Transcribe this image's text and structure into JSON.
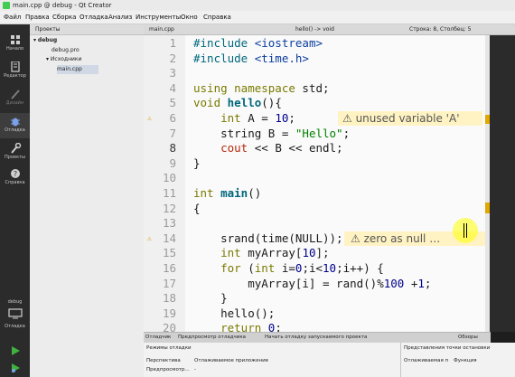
{
  "window": {
    "title": "main.cpp @ debug - Qt Creator"
  },
  "menu": [
    "Файл",
    "Правка",
    "Сборка",
    "Отладка",
    "Анализ",
    "Инструменты",
    "Окно",
    "Справка"
  ],
  "modes": [
    {
      "label": "Начало",
      "icon": "grid-icon"
    },
    {
      "label": "Редактор",
      "icon": "document-edit-icon"
    },
    {
      "label": "Дизайн",
      "icon": "pencil-icon"
    },
    {
      "label": "Отладка",
      "icon": "bug-icon"
    },
    {
      "label": "Проекты",
      "icon": "wrench-icon"
    },
    {
      "label": "Справка",
      "icon": "help-icon"
    }
  ],
  "kit": {
    "project": "debug",
    "label": "Отладка"
  },
  "projects": {
    "header": "Проекты",
    "tree": [
      {
        "label": "debug"
      },
      {
        "label": "debug.pro"
      },
      {
        "label": "Исходники"
      },
      {
        "label": "main.cpp"
      }
    ]
  },
  "editor": {
    "tab": "main.cpp",
    "symbol": "hello() -> void",
    "position": "Строка: 8, Столбец: 5",
    "lines": [
      {
        "n": "1",
        "segs": [
          [
            "pp",
            "#include "
          ],
          [
            "inc",
            "<iostream>"
          ]
        ]
      },
      {
        "n": "2",
        "segs": [
          [
            "pp",
            "#include "
          ],
          [
            "inc",
            "<time.h>"
          ]
        ]
      },
      {
        "n": "3",
        "segs": []
      },
      {
        "n": "4",
        "segs": [
          [
            "kw",
            "using namespace "
          ],
          [
            "",
            "std;"
          ]
        ]
      },
      {
        "n": "5",
        "segs": [
          [
            "kw",
            "void "
          ],
          [
            "fn",
            "hello"
          ],
          [
            "",
            "(){"
          ]
        ]
      },
      {
        "n": "6",
        "warn": true,
        "segs": [
          [
            "",
            "    "
          ],
          [
            "kw",
            "int "
          ],
          [
            "",
            "A = "
          ],
          [
            "num",
            "10"
          ],
          [
            "",
            ";"
          ]
        ]
      },
      {
        "n": "7",
        "segs": [
          [
            "",
            "    "
          ],
          [
            "",
            "string B = "
          ],
          [
            "str",
            "\"Hello\""
          ],
          [
            "",
            ";"
          ]
        ]
      },
      {
        "n": "8",
        "cur": true,
        "segs": [
          [
            "",
            "    "
          ],
          [
            "mac",
            "cout"
          ],
          [
            "",
            " << B << endl;"
          ]
        ]
      },
      {
        "n": "9",
        "segs": [
          [
            "",
            "}"
          ]
        ]
      },
      {
        "n": "10",
        "segs": []
      },
      {
        "n": "11",
        "segs": [
          [
            "kw",
            "int "
          ],
          [
            "fn",
            "main"
          ],
          [
            "",
            "()"
          ]
        ]
      },
      {
        "n": "12",
        "segs": [
          [
            "",
            "{"
          ]
        ]
      },
      {
        "n": "13",
        "segs": []
      },
      {
        "n": "14",
        "warn": true,
        "segs": [
          [
            "",
            "    "
          ],
          [
            "",
            "srand(time(NULL));"
          ]
        ]
      },
      {
        "n": "15",
        "segs": [
          [
            "",
            "    "
          ],
          [
            "kw",
            "int "
          ],
          [
            "",
            "myArray["
          ],
          [
            "num",
            "10"
          ],
          [
            "",
            "];"
          ]
        ]
      },
      {
        "n": "16",
        "segs": [
          [
            "",
            "    "
          ],
          [
            "kw",
            "for "
          ],
          [
            "",
            "("
          ],
          [
            "kw",
            "int "
          ],
          [
            "",
            "i="
          ],
          [
            "num",
            "0"
          ],
          [
            "",
            ";i<"
          ],
          [
            "num",
            "10"
          ],
          [
            "",
            ";i++) {"
          ]
        ]
      },
      {
        "n": "17",
        "segs": [
          [
            "",
            "        myArray[i] = rand()%"
          ],
          [
            "num",
            "100"
          ],
          [
            "",
            " +"
          ],
          [
            "num",
            "1"
          ],
          [
            "",
            ";"
          ]
        ]
      },
      {
        "n": "18",
        "segs": [
          [
            "",
            "    }"
          ]
        ]
      },
      {
        "n": "19",
        "segs": [
          [
            "",
            "    hello();"
          ]
        ]
      },
      {
        "n": "20",
        "segs": [
          [
            "",
            "    "
          ],
          [
            "kw",
            "return "
          ],
          [
            "num",
            "0"
          ],
          [
            "",
            ";"
          ]
        ]
      }
    ],
    "annotations": {
      "warn1": "⚠ unused variable 'A'",
      "warn2": "⚠ zero as null …"
    }
  },
  "debugger": {
    "tabs": [
      "Отладчик",
      "Предпросмотр отладчика",
      "Начать отладку запускаемого проекта"
    ],
    "views_label": "Обзоры",
    "modes_label": "Режимы отладки",
    "perspective_label": "Перспектива",
    "perspective_value": "Отлаживаемое приложение",
    "preview_label": "Предпросмотр...",
    "preview_value": "-",
    "breakpoints_header": "Представления точки остановки",
    "bp_col1": "Отлаживаемая п",
    "bp_col2": "Функция"
  }
}
